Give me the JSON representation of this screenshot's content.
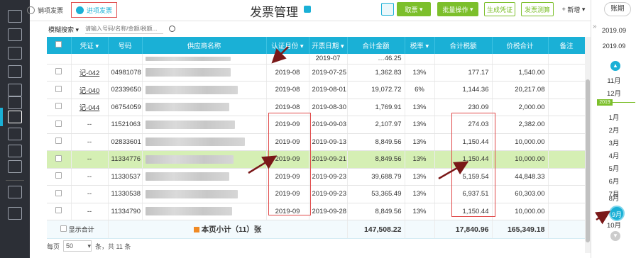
{
  "toolbar": {
    "tab_sales": "销项发票",
    "tab_purchase": "进项发票",
    "title": "发票管理",
    "btn_fetch": "取票",
    "btn_batch": "批量操作",
    "btn_gen_voucher": "生成凭证",
    "btn_invoice_calc": "发票测算",
    "btn_new": "新增"
  },
  "search": {
    "mode": "模糊搜索",
    "placeholder": "请输入号码/名称/金额/税额..."
  },
  "table": {
    "headers": [
      "凭证",
      "号码",
      "供应商名称",
      "认证月份",
      "开票日期",
      "合计金额",
      "税率",
      "合计税额",
      "价税合计",
      "备注"
    ],
    "partial_row": {
      "date": "2019-07",
      "amount": "…46.25"
    },
    "rows": [
      {
        "voucher": "记-042",
        "number": "04981078",
        "month": "2019-08",
        "date": "2019-07-25",
        "amount": "1,362.83",
        "rate": "13%",
        "tax": "177.17",
        "total": "1,540.00"
      },
      {
        "voucher": "记-040",
        "number": "02339650",
        "month": "2019-08",
        "date": "2019-08-01",
        "amount": "19,072.72",
        "rate": "6%",
        "tax": "1,144.36",
        "total": "20,217.08"
      },
      {
        "voucher": "记-044",
        "number": "06754059",
        "month": "2019-08",
        "date": "2019-08-30",
        "amount": "1,769.91",
        "rate": "13%",
        "tax": "230.09",
        "total": "2,000.00"
      },
      {
        "voucher": "--",
        "number": "11521063",
        "month": "2019-09",
        "date": "2019-09-03",
        "amount": "2,107.97",
        "rate": "13%",
        "tax": "274.03",
        "total": "2,382.00"
      },
      {
        "voucher": "--",
        "number": "02833601",
        "month": "2019-09",
        "date": "2019-09-13",
        "amount": "8,849.56",
        "rate": "13%",
        "tax": "1,150.44",
        "total": "10,000.00"
      },
      {
        "voucher": "--",
        "number": "11334776",
        "month": "2019-09",
        "date": "2019-09-21",
        "amount": "8,849.56",
        "rate": "13%",
        "tax": "1,150.44",
        "total": "10,000.00"
      },
      {
        "voucher": "--",
        "number": "11330537",
        "month": "2019-09",
        "date": "2019-09-23",
        "amount": "39,688.79",
        "rate": "13%",
        "tax": "5,159.54",
        "total": "44,848.33"
      },
      {
        "voucher": "--",
        "number": "11330538",
        "month": "2019-09",
        "date": "2019-09-23",
        "amount": "53,365.49",
        "rate": "13%",
        "tax": "6,937.51",
        "total": "60,303.00"
      },
      {
        "voucher": "--",
        "number": "11334790",
        "month": "2019-09",
        "date": "2019-09-28",
        "amount": "8,849.56",
        "rate": "13%",
        "tax": "1,150.44",
        "total": "10,000.00"
      }
    ],
    "summary": {
      "show_total": "显示合计",
      "label": "本页小计（11）张",
      "amount": "147,508.22",
      "tax": "17,840.96",
      "total": "165,349.18"
    }
  },
  "footer": {
    "per_page": "每页",
    "page_size": "50",
    "count_text": "条，共 11 条"
  },
  "period": {
    "button": "账期",
    "current": "2019.09",
    "months": [
      "11月",
      "12月",
      "1月",
      "2月",
      "3月",
      "4月",
      "5月",
      "6月",
      "7月",
      "8月"
    ],
    "year_tag": "2019",
    "selected": "9月",
    "next": "10月"
  },
  "colors": {
    "accent": "#1ab0d6",
    "green": "#7cbf2b",
    "highlight_row": "#d5efb4",
    "annotation": "#e04848",
    "arrow": "#7a1818"
  }
}
